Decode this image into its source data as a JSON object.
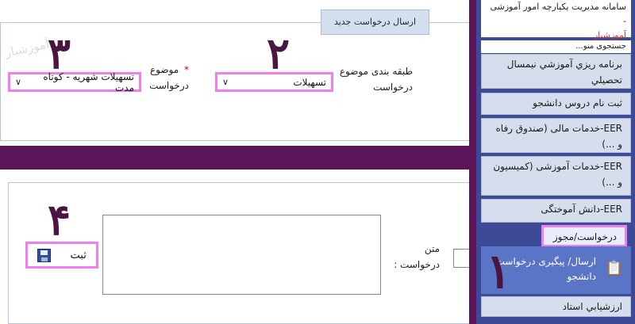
{
  "sidebar": {
    "header_line1": "سامانه مدیریت یکپارچه امور آموزشی -",
    "header_brand": "آموزشیار",
    "search_placeholder": "جستجوی منو...",
    "items": [
      {
        "label": "برنامه ريزي آموزشي نيمسال تحصيلي"
      },
      {
        "label": "ثبت نام دروس دانشجو"
      },
      {
        "label": "EER-خدمات مالی (صندوق رفاه و ...)"
      },
      {
        "label": "EER-خدمات آموزشی (کمیسیون و ...)"
      },
      {
        "label": "EER-دانش آموختگی"
      },
      {
        "label": "درخواست/مجوز"
      },
      {
        "label": "ارزشيابي استاد"
      }
    ],
    "sub_item": "ارسال/ پیگیری درخواست دانشجو"
  },
  "form": {
    "tab_label": "ارسال درخواست جدید",
    "category_label": "طبقه بندی موضوع درخواست",
    "category_value": "تسهیلات",
    "subject_label": "موضوع درخواست",
    "subject_required": "*",
    "subject_value": "تسهیلات شهریه - کوتاه مدت",
    "text_label": "متن درخواست :",
    "submit_label": "ثبت"
  },
  "annotations": {
    "n1": "۱",
    "n2": "۲",
    "n3": "۳",
    "n4": "۴",
    "watermark": "آموزشیار"
  }
}
